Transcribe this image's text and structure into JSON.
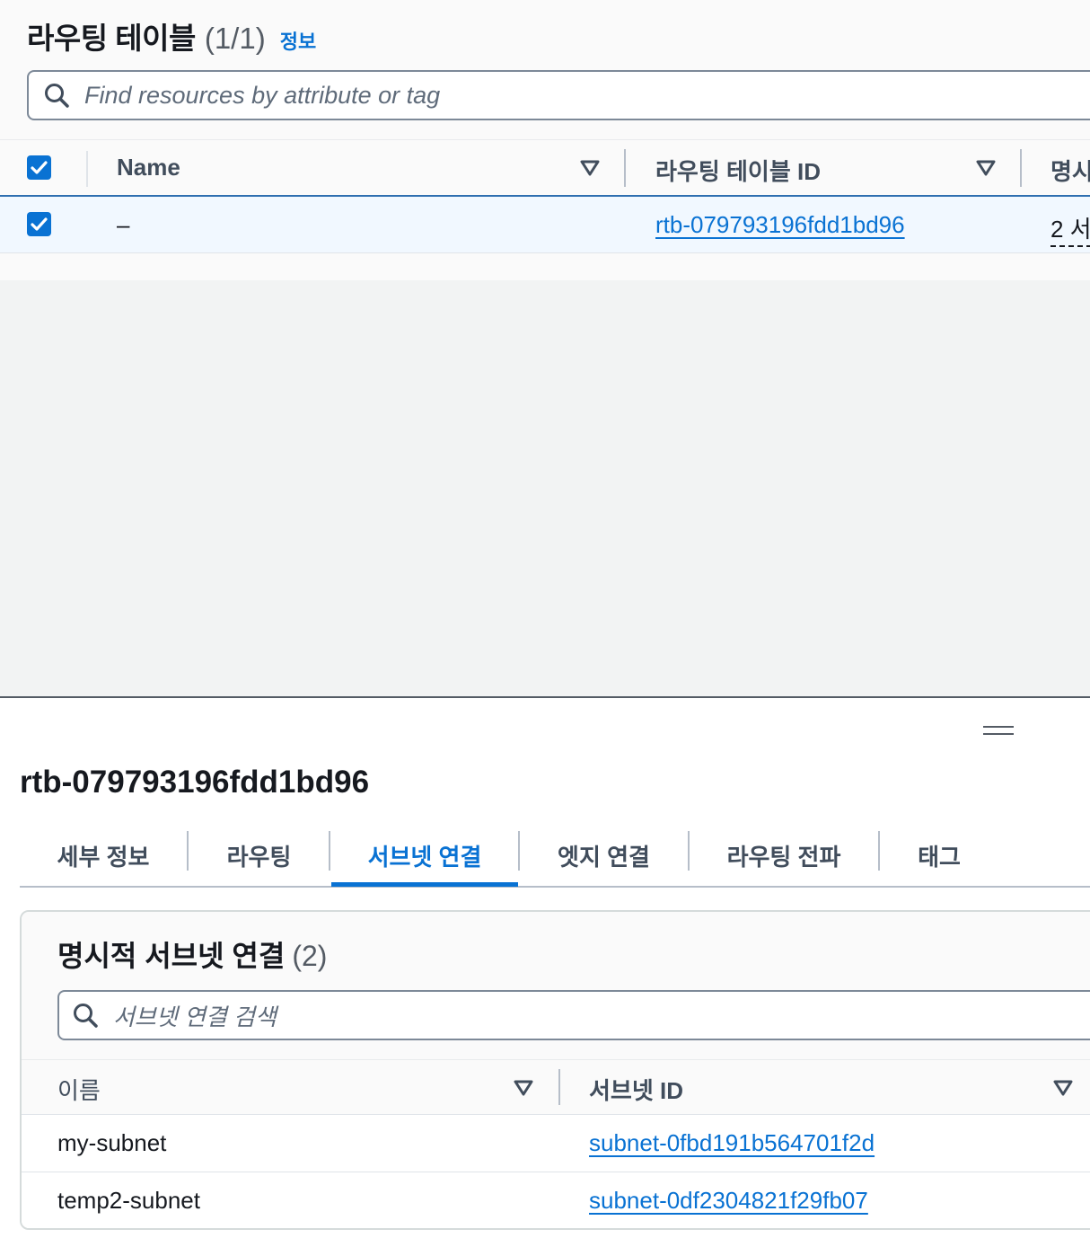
{
  "route_tables": {
    "title": "라우팅 테이블",
    "count": "(1/1)",
    "info_link": "정보",
    "search_placeholder": "Find resources by attribute or tag",
    "columns": {
      "name": "Name",
      "route_table_id": "라우팅 테이블 ID",
      "explicit_truncated": "명시"
    },
    "rows": [
      {
        "selected": true,
        "name": "–",
        "route_table_id": "rtb-079793196fdd1bd96",
        "explicit_truncated": "2 서"
      }
    ]
  },
  "detail": {
    "title": "rtb-079793196fdd1bd96",
    "tabs": [
      {
        "label": "세부 정보"
      },
      {
        "label": "라우팅"
      },
      {
        "label": "서브넷 연결",
        "active": true
      },
      {
        "label": "엣지 연결"
      },
      {
        "label": "라우팅 전파"
      },
      {
        "label": "태그"
      }
    ],
    "explicit_associations": {
      "title": "명시적 서브넷 연결",
      "count": "(2)",
      "search_placeholder": "서브넷 연결 검색",
      "columns": {
        "name": "이름",
        "subnet_id": "서브넷 ID"
      },
      "rows": [
        {
          "name": "my-subnet",
          "subnet_id": "subnet-0fbd191b564701f2d"
        },
        {
          "name": "temp2-subnet",
          "subnet_id": "subnet-0df2304821f29fb07"
        }
      ]
    }
  },
  "colors": {
    "accent": "#0972d3",
    "selected_row_bg": "#f1f8ff",
    "text": "#16191f",
    "muted_text": "#545b64"
  }
}
